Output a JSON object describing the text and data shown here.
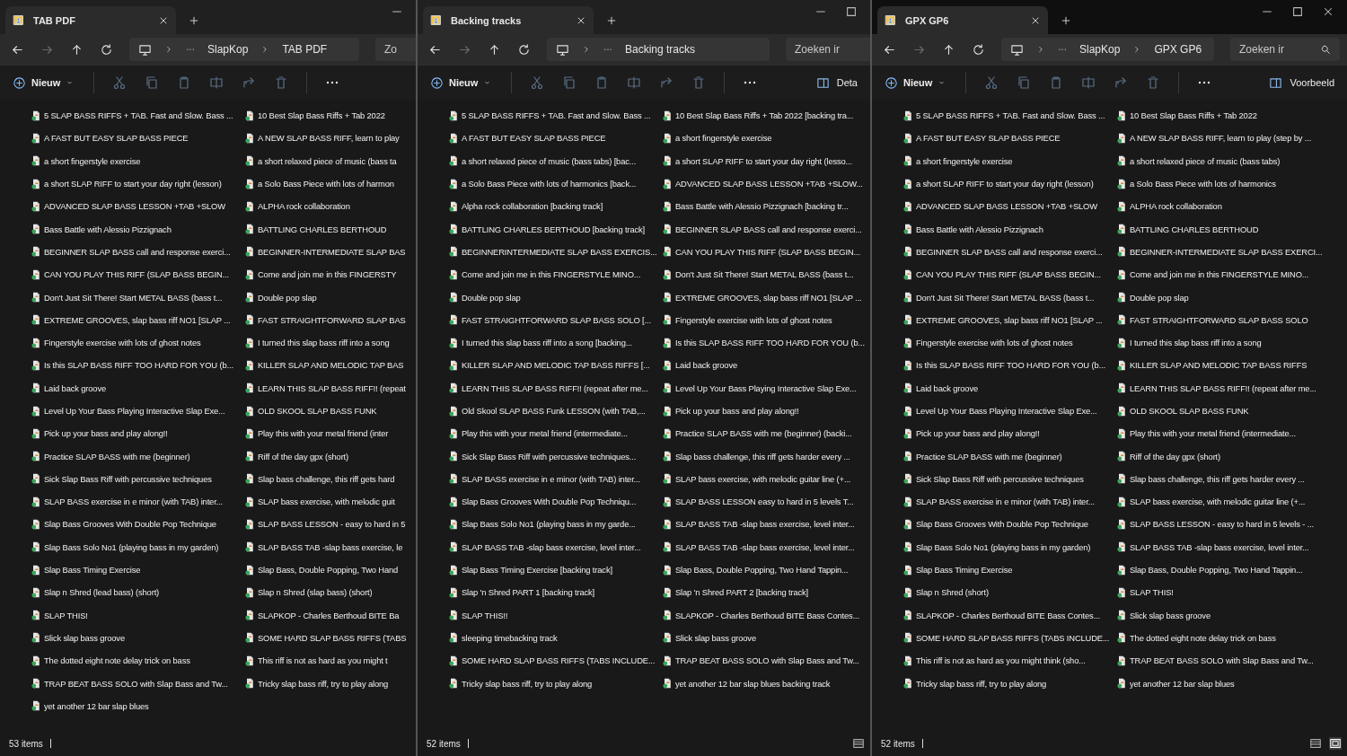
{
  "windows": [
    {
      "tab": {
        "title": "TAB PDF"
      },
      "window_controls": [
        {
          "kind": "minimize"
        }
      ],
      "nav_buttons": [
        {
          "kind": "back",
          "disabled": false
        },
        {
          "kind": "forward",
          "disabled": true
        },
        {
          "kind": "up",
          "disabled": false
        },
        {
          "kind": "refresh",
          "disabled": false
        }
      ],
      "breadcrumb": [
        "SlapKop",
        "TAB PDF"
      ],
      "search": {
        "placeholder": "Zo",
        "icon": false
      },
      "new_button": "Nieuw",
      "actions": [
        {
          "kind": "cut",
          "disabled": true
        },
        {
          "kind": "copy",
          "disabled": true
        },
        {
          "kind": "paste",
          "disabled": true
        },
        {
          "kind": "rename",
          "disabled": true
        },
        {
          "kind": "share",
          "disabled": true
        },
        {
          "kind": "delete",
          "disabled": true
        }
      ],
      "files": [
        "5 SLAP BASS RIFFS + TAB. Fast and Slow. Bass ...",
        "A FAST BUT EASY SLAP BASS PIECE",
        "a short fingerstyle exercise",
        "a short SLAP RIFF to start your day right (lesson)",
        "ADVANCED SLAP BASS LESSON +TAB +SLOW",
        "Bass Battle with Alessio Pizzignach",
        "BEGINNER SLAP BASS call and response exerci...",
        "CAN YOU PLAY THIS RIFF (SLAP BASS BEGIN...",
        "Don't Just Sit There! Start METAL BASS (bass t...",
        "EXTREME GROOVES, slap bass riff NO1 [SLAP ...",
        "Fingerstyle exercise with lots of ghost notes",
        "Is this SLAP BASS RIFF TOO HARD FOR YOU (b...",
        "Laid back groove",
        "Level Up Your Bass Playing Interactive Slap Exe...",
        "Pick up your bass and play along!!",
        "Practice SLAP BASS with me (beginner)",
        "Sick Slap Bass Riff with percussive techniques",
        "SLAP BASS exercise in e minor (with TAB) inter...",
        "Slap Bass Grooves With Double Pop Technique",
        "Slap Bass Solo No1 (playing bass in my garden)",
        "Slap Bass Timing Exercise",
        "Slap n Shred (lead bass) (short)",
        "SLAP THIS!",
        "Slick slap bass groove",
        "The dotted eight note delay trick on bass",
        "TRAP BEAT BASS SOLO with Slap Bass and Tw...",
        "yet another 12 bar slap blues",
        "10 Best Slap Bass Riffs + Tab 2022",
        "A NEW SLAP BASS RIFF, learn to play",
        "a short relaxed piece of music (bass ta",
        "a Solo Bass Piece with lots of harmon",
        "ALPHA rock collaboration",
        "BATTLING CHARLES BERTHOUD",
        "BEGINNER-INTERMEDIATE SLAP BAS",
        "Come and join me in this FINGERSTY",
        "Double pop slap",
        "FAST STRAIGHTFORWARD SLAP BAS",
        "I turned this slap bass riff into a song",
        "KILLER SLAP AND MELODIC TAP BAS",
        "LEARN THIS SLAP BASS RIFF!! (repeat",
        "OLD SKOOL SLAP BASS FUNK",
        "Play this with your metal friend (inter",
        "Riff of the day gpx (short)",
        "Slap bass challenge, this riff gets hard",
        "SLAP bass exercise, with melodic guit",
        "SLAP BASS LESSON - easy to hard in 5",
        "SLAP BASS TAB -slap bass exercise, le",
        "Slap Bass, Double Popping, Two Hand",
        "Slap n Shred (slap bass) (short)",
        "SLAPKOP - Charles Berthoud BITE Ba",
        "SOME HARD SLAP BASS RIFFS (TABS",
        "This riff is not as hard as you might t",
        "Tricky slap bass riff, try to play along"
      ],
      "status": "53 items"
    },
    {
      "tab": {
        "title": "Backing tracks"
      },
      "window_controls": [
        {
          "kind": "minimize"
        },
        {
          "kind": "maximize"
        }
      ],
      "nav_buttons": [
        {
          "kind": "back",
          "disabled": false
        },
        {
          "kind": "forward",
          "disabled": true
        },
        {
          "kind": "up",
          "disabled": false
        },
        {
          "kind": "refresh",
          "disabled": false
        }
      ],
      "breadcrumb": [
        "Backing tracks"
      ],
      "search": {
        "placeholder": "Zoeken ir",
        "icon": false
      },
      "new_button": "Nieuw",
      "actions": [
        {
          "kind": "cut",
          "disabled": true
        },
        {
          "kind": "copy",
          "disabled": true
        },
        {
          "kind": "paste",
          "disabled": true
        },
        {
          "kind": "rename",
          "disabled": true
        },
        {
          "kind": "share",
          "disabled": true
        },
        {
          "kind": "delete",
          "disabled": true
        }
      ],
      "pane_button": "Deta",
      "files": [
        "5 SLAP BASS RIFFS + TAB. Fast and Slow. Bass ...",
        "A FAST BUT EASY SLAP BASS PIECE",
        "a short relaxed piece of music (bass tabs) [bac...",
        "a Solo Bass Piece with lots of harmonics [back...",
        "Alpha rock collaboration [backing track]",
        "BATTLING CHARLES BERTHOUD [backing track]",
        "BEGINNERINTERMEDIATE SLAP BASS EXERCIS...",
        "Come and join me in this FINGERSTYLE MINO...",
        "Double pop slap",
        "FAST STRAIGHTFORWARD SLAP BASS SOLO [...",
        "I turned this slap bass riff into a song [backing...",
        "KILLER SLAP AND MELODIC TAP BASS RIFFS [...",
        "LEARN THIS SLAP BASS RIFF!! (repeat after me...",
        "Old Skool SLAP BASS Funk LESSON (with TAB,...",
        "Play this with your metal friend (intermediate...",
        "Sick Slap Bass Riff with percussive techniques...",
        "SLAP BASS exercise in e minor (with TAB) inter...",
        "Slap Bass Grooves With Double Pop Techniqu...",
        "Slap Bass Solo No1 (playing bass in my garde...",
        "SLAP BASS TAB -slap bass exercise, level inter...",
        "Slap Bass Timing Exercise [backing track]",
        "Slap 'n Shred PART 1 [backing track]",
        "SLAP THIS!!",
        "sleeping timebacking track",
        "SOME HARD SLAP BASS RIFFS (TABS INCLUDE...",
        "Tricky slap bass riff, try to play along",
        "10 Best Slap Bass Riffs + Tab 2022 [backing tra...",
        "a short fingerstyle exercise",
        "a short SLAP RIFF to start your day right (lesso...",
        "ADVANCED SLAP BASS LESSON +TAB +SLOW...",
        "Bass Battle with Alessio Pizzignach [backing tr...",
        "BEGINNER SLAP BASS call and response exerci...",
        "CAN YOU PLAY THIS RIFF (SLAP BASS BEGIN...",
        "Don't Just Sit There! Start METAL BASS (bass t...",
        "EXTREME GROOVES, slap bass riff NO1 [SLAP ...",
        "Fingerstyle exercise with lots of ghost notes",
        "Is this SLAP BASS RIFF TOO HARD FOR YOU (b...",
        "Laid back groove",
        "Level Up Your Bass Playing Interactive Slap Exe...",
        "Pick up your bass and play along!!",
        "Practice SLAP BASS with me (beginner) (backi...",
        "Slap bass challenge, this riff gets harder every ...",
        "SLAP bass exercise, with melodic guitar line (+...",
        "SLAP BASS LESSON  easy to hard in 5 levels  T...",
        "SLAP BASS TAB -slap bass exercise, level inter...",
        "SLAP BASS TAB -slap bass exercise, level inter...",
        "Slap Bass, Double Popping, Two Hand Tappin...",
        "Slap 'n Shred PART 2 [backing track]",
        "SLAPKOP - Charles Berthoud BITE Bass Contes...",
        "Slick slap bass groove",
        "TRAP BEAT BASS SOLO with Slap Bass and Tw...",
        "yet another 12 bar slap blues backing track"
      ],
      "status": "52 items",
      "view_buttons": [
        {
          "kind": "details",
          "selected": false
        }
      ]
    },
    {
      "tab": {
        "title": "GPX GP6"
      },
      "window_controls": [
        {
          "kind": "minimize"
        },
        {
          "kind": "maximize"
        },
        {
          "kind": "close"
        }
      ],
      "nav_buttons": [
        {
          "kind": "back",
          "disabled": false
        },
        {
          "kind": "forward",
          "disabled": true
        },
        {
          "kind": "up",
          "disabled": false
        },
        {
          "kind": "refresh",
          "disabled": false
        }
      ],
      "breadcrumb": [
        "SlapKop",
        "GPX GP6"
      ],
      "search": {
        "placeholder": "Zoeken ir",
        "icon": true
      },
      "new_button": "Nieuw",
      "actions": [
        {
          "kind": "cut",
          "disabled": true
        },
        {
          "kind": "copy",
          "disabled": true
        },
        {
          "kind": "paste",
          "disabled": true
        },
        {
          "kind": "rename",
          "disabled": true
        },
        {
          "kind": "share",
          "disabled": true
        },
        {
          "kind": "delete",
          "disabled": true
        }
      ],
      "pane_button": "Voorbeeld",
      "files": [
        "5 SLAP BASS RIFFS + TAB. Fast and Slow. Bass ...",
        "A FAST BUT EASY SLAP BASS PIECE",
        "a short fingerstyle exercise",
        "a short SLAP RIFF to start your day right (lesson)",
        "ADVANCED SLAP BASS LESSON +TAB +SLOW",
        "Bass Battle with Alessio Pizzignach",
        "BEGINNER SLAP BASS call and response exerci...",
        "CAN YOU PLAY THIS RIFF (SLAP BASS BEGIN...",
        "Don't Just Sit There! Start METAL BASS (bass t...",
        "EXTREME GROOVES, slap bass riff NO1 [SLAP ...",
        "Fingerstyle exercise with lots of ghost notes",
        "Is this SLAP BASS RIFF TOO HARD FOR YOU (b...",
        "Laid back groove",
        "Level Up Your Bass Playing Interactive Slap Exe...",
        "Pick up your bass and play along!!",
        "Practice SLAP BASS with me (beginner)",
        "Sick Slap Bass Riff with percussive techniques",
        "SLAP BASS exercise in e minor (with TAB) inter...",
        "Slap Bass Grooves With Double Pop Technique",
        "Slap Bass Solo No1 (playing bass in my garden)",
        "Slap Bass Timing Exercise",
        "Slap n Shred (short)",
        "SLAPKOP - Charles Berthoud BITE Bass Contes...",
        "SOME HARD SLAP BASS RIFFS (TABS INCLUDE...",
        "This riff is not as hard as you might think (sho...",
        "Tricky slap bass riff, try to play along",
        "10 Best Slap Bass Riffs + Tab 2022",
        "A NEW SLAP BASS RIFF, learn to play (step by ...",
        "a short relaxed piece of music (bass tabs)",
        "a Solo Bass Piece with lots of harmonics",
        "ALPHA rock collaboration",
        "BATTLING CHARLES BERTHOUD",
        "BEGINNER-INTERMEDIATE SLAP BASS EXERCI...",
        "Come and join me in this FINGERSTYLE MINO...",
        "Double pop slap",
        "FAST STRAIGHTFORWARD SLAP BASS SOLO",
        "I turned this slap bass riff into a song",
        "KILLER SLAP AND MELODIC TAP BASS RIFFS",
        "LEARN THIS SLAP BASS RIFF!! (repeat after me...",
        "OLD SKOOL SLAP BASS FUNK",
        "Play this with your metal friend (intermediate...",
        "Riff of the day gpx (short)",
        "Slap bass challenge, this riff gets harder every ...",
        "SLAP bass exercise, with melodic guitar line (+...",
        "SLAP BASS LESSON - easy to hard in 5 levels - ...",
        "SLAP BASS TAB -slap bass exercise, level inter...",
        "Slap Bass, Double Popping, Two Hand Tappin...",
        "SLAP THIS!",
        "Slick slap bass groove",
        "The dotted eight note delay trick on bass",
        "TRAP BEAT BASS SOLO with Slap Bass and Tw...",
        "yet another 12 bar slap blues"
      ],
      "status": "52 items",
      "view_buttons": [
        {
          "kind": "details",
          "selected": false
        },
        {
          "kind": "tiles",
          "selected": true
        }
      ]
    }
  ]
}
